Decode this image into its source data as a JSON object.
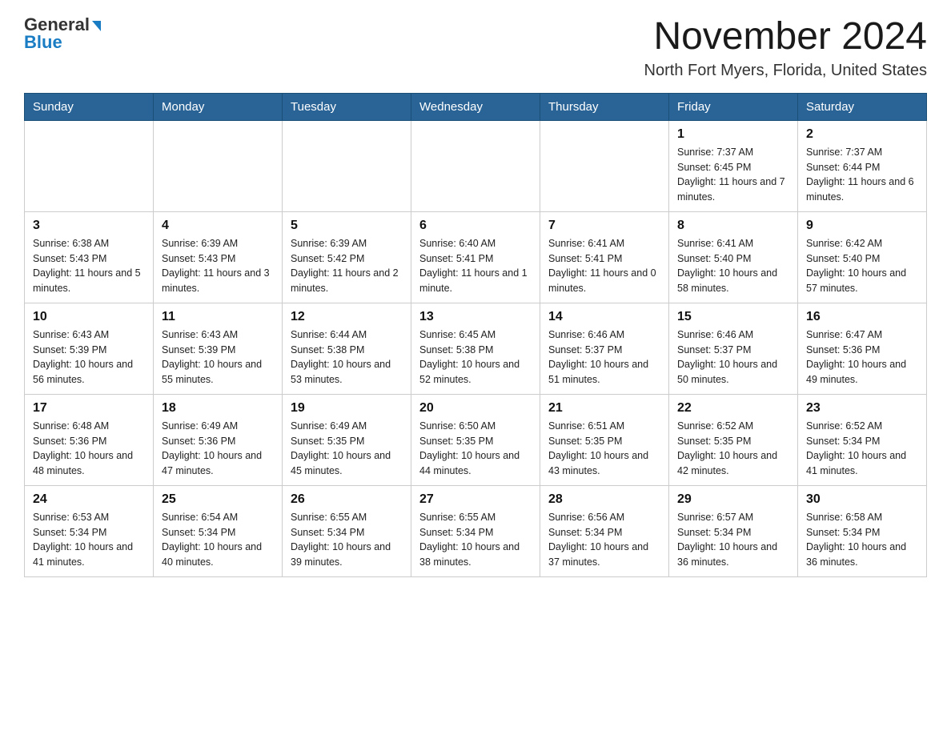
{
  "logo": {
    "general": "General",
    "blue": "Blue",
    "arrow": "▶"
  },
  "header": {
    "month_year": "November 2024",
    "location": "North Fort Myers, Florida, United States"
  },
  "weekdays": [
    "Sunday",
    "Monday",
    "Tuesday",
    "Wednesday",
    "Thursday",
    "Friday",
    "Saturday"
  ],
  "weeks": [
    [
      {
        "day": "",
        "info": ""
      },
      {
        "day": "",
        "info": ""
      },
      {
        "day": "",
        "info": ""
      },
      {
        "day": "",
        "info": ""
      },
      {
        "day": "",
        "info": ""
      },
      {
        "day": "1",
        "info": "Sunrise: 7:37 AM\nSunset: 6:45 PM\nDaylight: 11 hours and 7 minutes."
      },
      {
        "day": "2",
        "info": "Sunrise: 7:37 AM\nSunset: 6:44 PM\nDaylight: 11 hours and 6 minutes."
      }
    ],
    [
      {
        "day": "3",
        "info": "Sunrise: 6:38 AM\nSunset: 5:43 PM\nDaylight: 11 hours and 5 minutes."
      },
      {
        "day": "4",
        "info": "Sunrise: 6:39 AM\nSunset: 5:43 PM\nDaylight: 11 hours and 3 minutes."
      },
      {
        "day": "5",
        "info": "Sunrise: 6:39 AM\nSunset: 5:42 PM\nDaylight: 11 hours and 2 minutes."
      },
      {
        "day": "6",
        "info": "Sunrise: 6:40 AM\nSunset: 5:41 PM\nDaylight: 11 hours and 1 minute."
      },
      {
        "day": "7",
        "info": "Sunrise: 6:41 AM\nSunset: 5:41 PM\nDaylight: 11 hours and 0 minutes."
      },
      {
        "day": "8",
        "info": "Sunrise: 6:41 AM\nSunset: 5:40 PM\nDaylight: 10 hours and 58 minutes."
      },
      {
        "day": "9",
        "info": "Sunrise: 6:42 AM\nSunset: 5:40 PM\nDaylight: 10 hours and 57 minutes."
      }
    ],
    [
      {
        "day": "10",
        "info": "Sunrise: 6:43 AM\nSunset: 5:39 PM\nDaylight: 10 hours and 56 minutes."
      },
      {
        "day": "11",
        "info": "Sunrise: 6:43 AM\nSunset: 5:39 PM\nDaylight: 10 hours and 55 minutes."
      },
      {
        "day": "12",
        "info": "Sunrise: 6:44 AM\nSunset: 5:38 PM\nDaylight: 10 hours and 53 minutes."
      },
      {
        "day": "13",
        "info": "Sunrise: 6:45 AM\nSunset: 5:38 PM\nDaylight: 10 hours and 52 minutes."
      },
      {
        "day": "14",
        "info": "Sunrise: 6:46 AM\nSunset: 5:37 PM\nDaylight: 10 hours and 51 minutes."
      },
      {
        "day": "15",
        "info": "Sunrise: 6:46 AM\nSunset: 5:37 PM\nDaylight: 10 hours and 50 minutes."
      },
      {
        "day": "16",
        "info": "Sunrise: 6:47 AM\nSunset: 5:36 PM\nDaylight: 10 hours and 49 minutes."
      }
    ],
    [
      {
        "day": "17",
        "info": "Sunrise: 6:48 AM\nSunset: 5:36 PM\nDaylight: 10 hours and 48 minutes."
      },
      {
        "day": "18",
        "info": "Sunrise: 6:49 AM\nSunset: 5:36 PM\nDaylight: 10 hours and 47 minutes."
      },
      {
        "day": "19",
        "info": "Sunrise: 6:49 AM\nSunset: 5:35 PM\nDaylight: 10 hours and 45 minutes."
      },
      {
        "day": "20",
        "info": "Sunrise: 6:50 AM\nSunset: 5:35 PM\nDaylight: 10 hours and 44 minutes."
      },
      {
        "day": "21",
        "info": "Sunrise: 6:51 AM\nSunset: 5:35 PM\nDaylight: 10 hours and 43 minutes."
      },
      {
        "day": "22",
        "info": "Sunrise: 6:52 AM\nSunset: 5:35 PM\nDaylight: 10 hours and 42 minutes."
      },
      {
        "day": "23",
        "info": "Sunrise: 6:52 AM\nSunset: 5:34 PM\nDaylight: 10 hours and 41 minutes."
      }
    ],
    [
      {
        "day": "24",
        "info": "Sunrise: 6:53 AM\nSunset: 5:34 PM\nDaylight: 10 hours and 41 minutes."
      },
      {
        "day": "25",
        "info": "Sunrise: 6:54 AM\nSunset: 5:34 PM\nDaylight: 10 hours and 40 minutes."
      },
      {
        "day": "26",
        "info": "Sunrise: 6:55 AM\nSunset: 5:34 PM\nDaylight: 10 hours and 39 minutes."
      },
      {
        "day": "27",
        "info": "Sunrise: 6:55 AM\nSunset: 5:34 PM\nDaylight: 10 hours and 38 minutes."
      },
      {
        "day": "28",
        "info": "Sunrise: 6:56 AM\nSunset: 5:34 PM\nDaylight: 10 hours and 37 minutes."
      },
      {
        "day": "29",
        "info": "Sunrise: 6:57 AM\nSunset: 5:34 PM\nDaylight: 10 hours and 36 minutes."
      },
      {
        "day": "30",
        "info": "Sunrise: 6:58 AM\nSunset: 5:34 PM\nDaylight: 10 hours and 36 minutes."
      }
    ]
  ]
}
